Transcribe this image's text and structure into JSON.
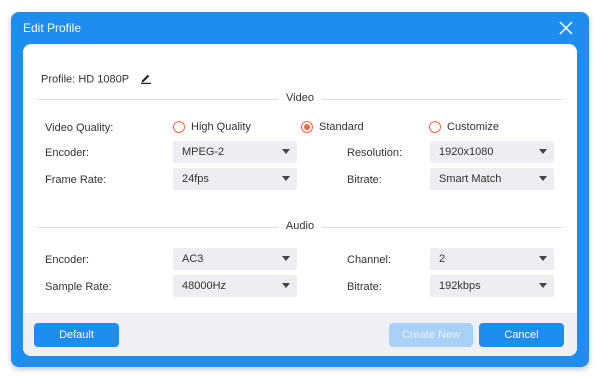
{
  "dialog": {
    "title": "Edit Profile"
  },
  "profile": {
    "label": "Profile:",
    "value": "HD 1080P"
  },
  "video": {
    "heading": "Video",
    "quality_label": "Video Quality:",
    "quality_options": [
      "High Quality",
      "Standard",
      "Customize"
    ],
    "quality_selected": "Standard",
    "encoder_label": "Encoder:",
    "encoder_value": "MPEG-2",
    "resolution_label": "Resolution:",
    "resolution_value": "1920x1080",
    "framerate_label": "Frame Rate:",
    "framerate_value": "24fps",
    "bitrate_label": "Bitrate:",
    "bitrate_value": "Smart Match"
  },
  "audio": {
    "heading": "Audio",
    "encoder_label": "Encoder:",
    "encoder_value": "AC3",
    "channel_label": "Channel:",
    "channel_value": "2",
    "samplerate_label": "Sample Rate:",
    "samplerate_value": "48000Hz",
    "bitrate_label": "Bitrate:",
    "bitrate_value": "192kbps"
  },
  "buttons": {
    "default_label": "Default",
    "create_label": "Create New",
    "cancel_label": "Cancel"
  },
  "icons": {
    "close": "close-icon",
    "edit": "pencil-icon",
    "radio": "radio-button",
    "dropdown": "chevron-down-icon"
  },
  "colors": {
    "accent": "#1f8cf0",
    "radio": "#f26a3d",
    "disabled_button": "#a9d1f7",
    "footer_bg": "#eef0f3",
    "select_bg": "#eceef1"
  }
}
